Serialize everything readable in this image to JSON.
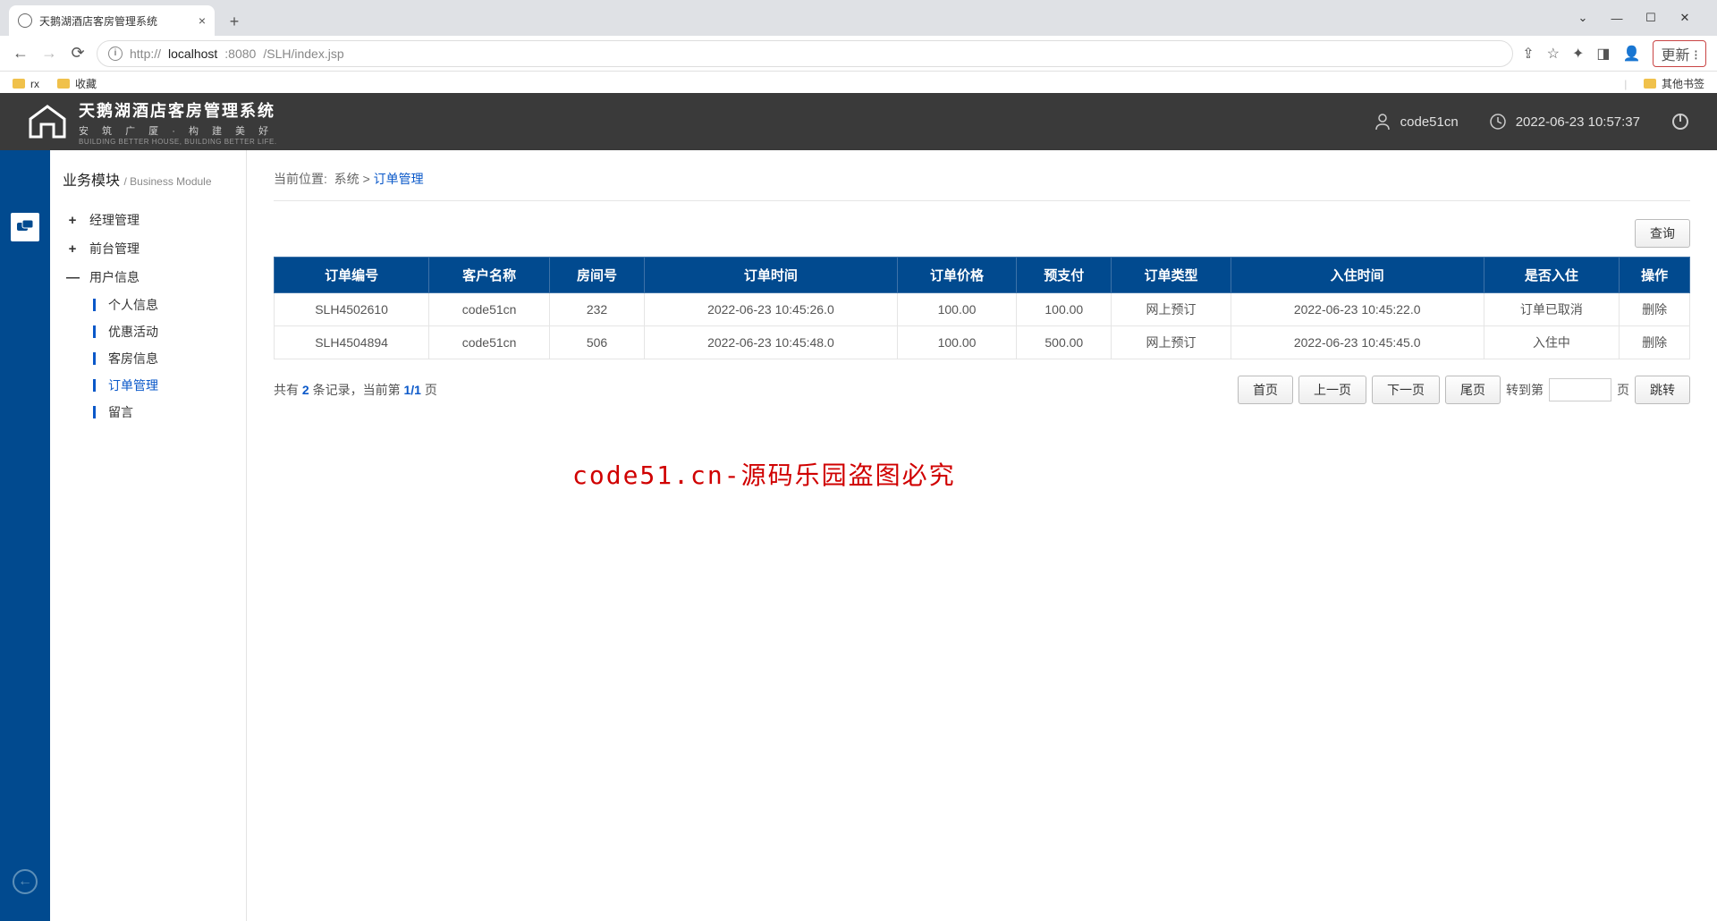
{
  "browser": {
    "tabTitle": "天鹅湖酒店客房管理系统",
    "url_prefix": "http://",
    "url_host": "localhost",
    "url_port": ":8080",
    "url_path": "/SLH/index.jsp",
    "updateLabel": "更新",
    "bookmarks": {
      "rx": "rx",
      "fav": "收藏",
      "other": "其他书签"
    }
  },
  "header": {
    "title": "天鹅湖酒店客房管理系统",
    "subtitle": "安 筑 广 厦 · 构 建 美 好",
    "subtitle2": "BUILDING BETTER HOUSE, BUILDING BETTER LIFE.",
    "user": "code51cn",
    "datetime": "2022-06-23 10:57:37"
  },
  "sidebar": {
    "title": "业务模块",
    "titleSub": "/ Business Module",
    "items": [
      {
        "label": "经理管理",
        "expand": "+"
      },
      {
        "label": "前台管理",
        "expand": "+"
      },
      {
        "label": "用户信息",
        "expand": "—",
        "subs": [
          {
            "label": "个人信息"
          },
          {
            "label": "优惠活动"
          },
          {
            "label": "客房信息"
          },
          {
            "label": "订单管理",
            "active": true
          },
          {
            "label": "留言"
          }
        ]
      }
    ]
  },
  "breadcrumb": {
    "prefix": "当前位置:",
    "part1": "系统",
    "sep": ">",
    "current": "订单管理"
  },
  "buttons": {
    "query": "查询"
  },
  "table": {
    "headers": [
      "订单编号",
      "客户名称",
      "房间号",
      "订单时间",
      "订单价格",
      "预支付",
      "订单类型",
      "入住时间",
      "是否入住",
      "操作"
    ],
    "rows": [
      [
        "SLH4502610",
        "code51cn",
        "232",
        "2022-06-23 10:45:26.0",
        "100.00",
        "100.00",
        "网上预订",
        "2022-06-23 10:45:22.0",
        "订单已取消",
        "删除"
      ],
      [
        "SLH4504894",
        "code51cn",
        "506",
        "2022-06-23 10:45:48.0",
        "100.00",
        "500.00",
        "网上预订",
        "2022-06-23 10:45:45.0",
        "入住中",
        "删除"
      ]
    ]
  },
  "pager": {
    "totalPrefix": "共有",
    "total": "2",
    "totalSuffix": "条记录，当前第",
    "page": "1/1",
    "pageSuffix": "页",
    "first": "首页",
    "prev": "上一页",
    "next": "下一页",
    "last": "尾页",
    "gotoPrefix": "转到第",
    "gotoSuffix": "页",
    "jump": "跳转"
  },
  "watermark": "code51.cn-源码乐园盗图必究"
}
